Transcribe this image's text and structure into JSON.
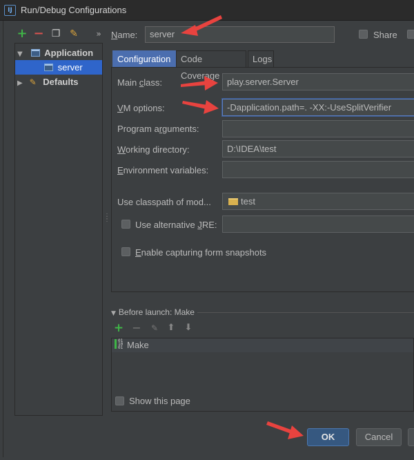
{
  "window": {
    "title": "Run/Debug Configurations",
    "icon_text": "IJ"
  },
  "toolbar": {
    "icons": [
      "add-icon",
      "remove-icon",
      "copy-icon",
      "wrench-icon",
      "more-icon"
    ]
  },
  "tree": {
    "application": "Application",
    "server": "server",
    "defaults": "Defaults"
  },
  "name": {
    "label": "Name:",
    "value": "server"
  },
  "share": {
    "label": "Share"
  },
  "tabs": {
    "configuration": "Configuration",
    "coverage": "Code Coverage",
    "logs": "Logs"
  },
  "fields": {
    "main_class": {
      "label": "Main class:",
      "value": "play.server.Server"
    },
    "vm_options": {
      "label": "VM options:",
      "value": "-Dapplication.path=. -XX:-UseSplitVerifier"
    },
    "program_args": {
      "label": "Program arguments:",
      "value": ""
    },
    "working_dir": {
      "label": "Working directory:",
      "value": "D:\\IDEA\\test"
    },
    "env_vars": {
      "label": "Environment variables:",
      "value": ""
    },
    "classpath": {
      "label": "Use classpath of mod...",
      "value": "test"
    },
    "alt_jre": {
      "label": "Use alternative JRE:",
      "value": ""
    },
    "snapshots": {
      "label": "Enable capturing form snapshots"
    }
  },
  "before_launch": {
    "title": "Before launch: Make",
    "item": "Make"
  },
  "show_page": {
    "label": "Show this page"
  },
  "buttons": {
    "ok": "OK",
    "cancel": "Cancel"
  },
  "colors": {
    "selection": "#2f65ca",
    "arrow": "#e8433f",
    "ok_bg": "#365880"
  }
}
